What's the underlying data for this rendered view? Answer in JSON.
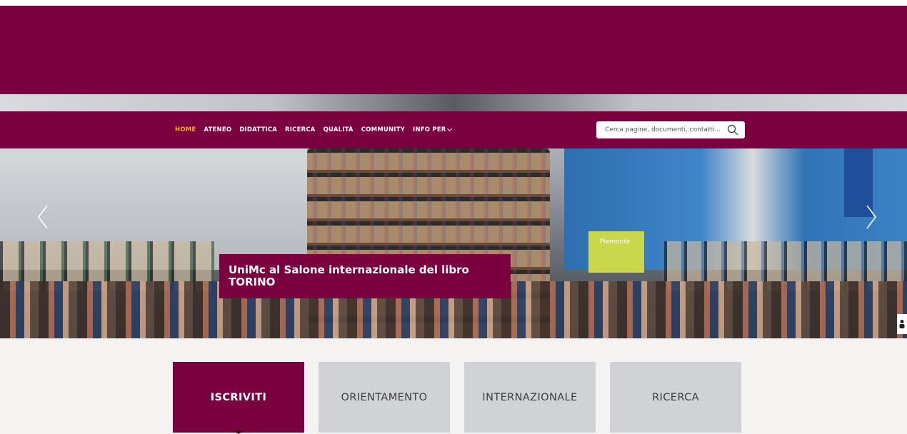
{
  "colors": {
    "brand": "#7b0040",
    "active_nav": "#f0b21e",
    "tile_secondary": "#d1d2d5",
    "tiles_background": "#f4f3f1"
  },
  "nav": {
    "items": [
      {
        "label": "HOME",
        "active": true
      },
      {
        "label": "ATENEO",
        "active": false
      },
      {
        "label": "DIDATTICA",
        "active": false
      },
      {
        "label": "RICERCA",
        "active": false
      },
      {
        "label": "QUALITÀ",
        "active": false
      },
      {
        "label": "COMMUNITY",
        "active": false
      },
      {
        "label": "INFO PER",
        "active": false,
        "dropdown": true
      }
    ]
  },
  "search": {
    "placeholder": "Cerca pagine, documenti, contatti...",
    "icon": "search-icon"
  },
  "hero": {
    "caption": "UniMc al Salone internazionale del libro\nTORINO",
    "banner_text": "Piemonte",
    "prev_icon": "chevron-left-icon",
    "next_icon": "chevron-right-icon"
  },
  "tiles": [
    {
      "label": "ISCRIVITI",
      "style": "primary"
    },
    {
      "label": "ORIENTAMENTO",
      "style": "secondary"
    },
    {
      "label": "INTERNAZIONALE",
      "style": "secondary"
    },
    {
      "label": "RICERCA",
      "style": "secondary"
    }
  ]
}
